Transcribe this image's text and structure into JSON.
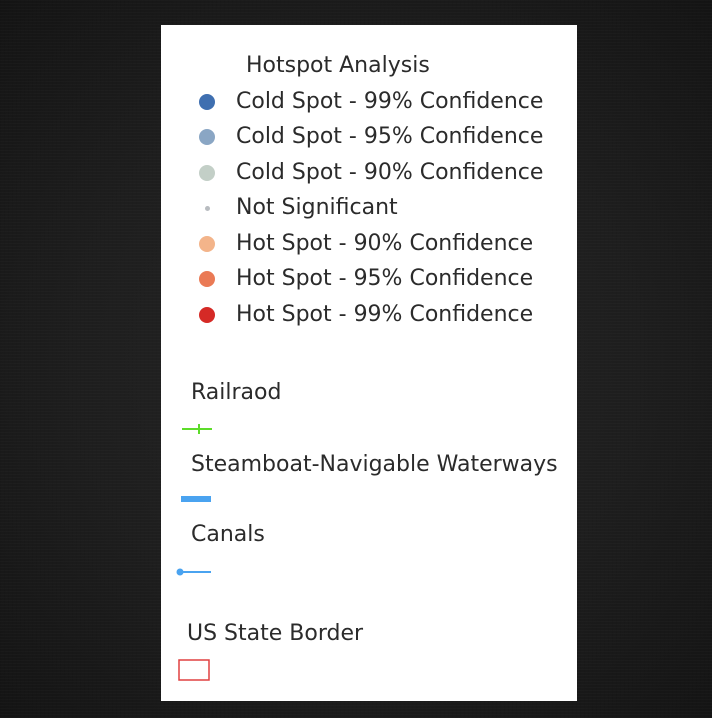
{
  "legend": {
    "hotspot_title": "Hotspot Analysis",
    "hotspot_items": [
      {
        "label": "Cold Spot - 99% Confidence",
        "color": "#3f6fb0"
      },
      {
        "label": "Cold Spot - 95% Confidence",
        "color": "#8aa6c4"
      },
      {
        "label": "Cold Spot - 90% Confidence",
        "color": "#c3cfc7"
      },
      {
        "label": "Not Significant",
        "color": "#b8bcc0"
      },
      {
        "label": "Hot Spot - 90% Confidence",
        "color": "#f3b48a"
      },
      {
        "label": "Hot Spot - 95% Confidence",
        "color": "#ea7a55"
      },
      {
        "label": "Hot Spot - 99% Confidence",
        "color": "#d52a26"
      }
    ],
    "railroad": {
      "label": "Railraod",
      "color": "#5ddc2a",
      "icon": "railroad-line-icon"
    },
    "waterways": {
      "label": "Steamboat-Navigable Waterways",
      "color": "#4aa3f0",
      "icon": "waterway-line-icon"
    },
    "canals": {
      "label": "Canals",
      "color": "#4aa3f0",
      "icon": "canal-line-icon"
    },
    "state_border": {
      "label": "US State Border",
      "color": "#e04040",
      "icon": "state-border-box-icon"
    }
  }
}
